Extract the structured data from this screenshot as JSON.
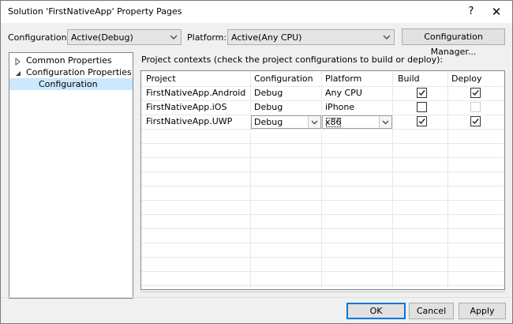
{
  "window": {
    "title": "Solution 'FirstNativeApp' Property Pages",
    "help_glyph": "?",
    "close_glyph": "✕"
  },
  "toolbar": {
    "configuration_label": "Configuration:",
    "configuration_value": "Active(Debug)",
    "platform_label": "Platform:",
    "platform_value": "Active(Any CPU)",
    "config_manager_label": "Configuration Manager..."
  },
  "tree": {
    "items": [
      {
        "label": "Common Properties",
        "expander": "collapsed"
      },
      {
        "label": "Configuration Properties",
        "expander": "expanded"
      },
      {
        "label": "Configuration",
        "selected": true
      }
    ]
  },
  "main": {
    "caption": "Project contexts (check the project configurations to build or deploy):",
    "columns": [
      "Project",
      "Configuration",
      "Platform",
      "Build",
      "Deploy"
    ],
    "rows": [
      {
        "project": "FirstNativeApp.Android",
        "configuration": "Debug",
        "platform": "Any CPU",
        "build": true,
        "deploy": true,
        "deploy_enabled": true
      },
      {
        "project": "FirstNativeApp.iOS",
        "configuration": "Debug",
        "platform": "iPhone",
        "build": false,
        "deploy": false,
        "deploy_enabled": false
      },
      {
        "project": "FirstNativeApp.UWP",
        "configuration": "Debug",
        "platform": "x86",
        "build": true,
        "deploy": true,
        "deploy_enabled": true
      }
    ]
  },
  "footer": {
    "ok_label": "OK",
    "cancel_label": "Cancel",
    "apply_label": "Apply"
  },
  "colors": {
    "selection": "#cce8ff",
    "default_button_border": "#0078d7",
    "window_bg": "#f0f0f0"
  }
}
